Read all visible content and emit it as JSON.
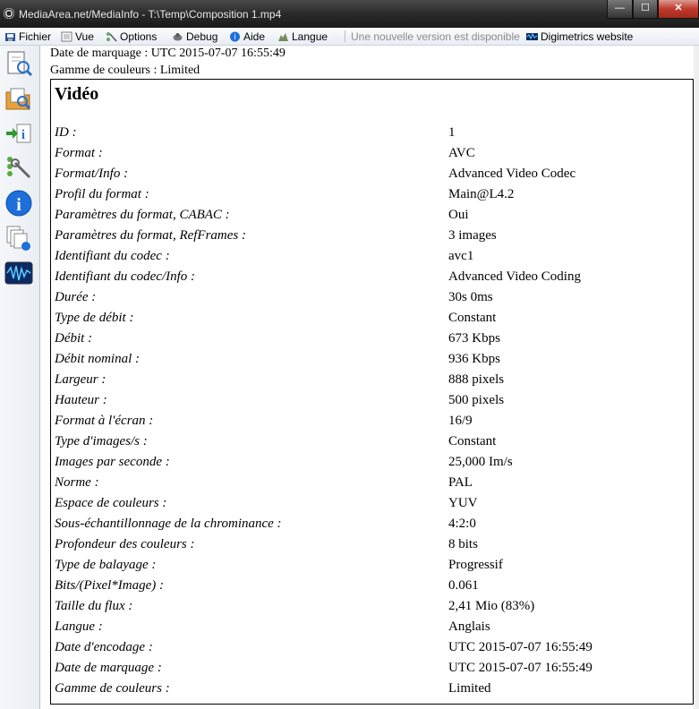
{
  "window": {
    "title": "MediaArea.net/MediaInfo - T:\\Temp\\Composition 1.mp4",
    "controls": {
      "minimize": "—",
      "maximize": "☐",
      "close": "✕"
    }
  },
  "menu": {
    "items": [
      {
        "label": "Fichier",
        "icon": "file-icon"
      },
      {
        "label": "Vue",
        "icon": "view-icon"
      },
      {
        "label": "Options",
        "icon": "options-icon"
      },
      {
        "label": "Debug",
        "icon": "debug-icon"
      },
      {
        "label": "Aide",
        "icon": "help-icon"
      },
      {
        "label": "Langue",
        "icon": "language-icon"
      }
    ],
    "update_notice": "Une nouvelle version est disponible",
    "website": {
      "label": "Digimetrics website",
      "icon": "digimetrics-icon"
    }
  },
  "toolbar": {
    "buttons": [
      {
        "icon": "open-file-icon"
      },
      {
        "icon": "open-folder-icon"
      },
      {
        "icon": "export-info-icon"
      },
      {
        "icon": "preferences-icon"
      },
      {
        "icon": "about-icon"
      },
      {
        "icon": "sheet-view-icon"
      },
      {
        "icon": "waveform-icon"
      }
    ]
  },
  "content": {
    "previous_lines": [
      "Date de marquage : UTC 2015-07-07 16:55:49",
      "Gamme de couleurs : Limited"
    ],
    "video": {
      "title": "Vidéo",
      "rows": [
        {
          "key": "ID :",
          "value": "1"
        },
        {
          "key": "Format :",
          "value": "AVC"
        },
        {
          "key": "Format/Info :",
          "value": "Advanced Video Codec"
        },
        {
          "key": "Profil du format :",
          "value": "Main@L4.2"
        },
        {
          "key": "Paramètres du format, CABAC :",
          "value": "Oui"
        },
        {
          "key": "Paramètres du format, RefFrames :",
          "value": "3 images"
        },
        {
          "key": "Identifiant du codec :",
          "value": "avc1"
        },
        {
          "key": "Identifiant du codec/Info :",
          "value": "Advanced Video Coding"
        },
        {
          "key": "Durée :",
          "value": "30s 0ms"
        },
        {
          "key": "Type de débit :",
          "value": "Constant"
        },
        {
          "key": "Débit :",
          "value": "673 Kbps"
        },
        {
          "key": "Débit nominal :",
          "value": "936 Kbps"
        },
        {
          "key": "Largeur :",
          "value": "888 pixels"
        },
        {
          "key": "Hauteur :",
          "value": "500 pixels"
        },
        {
          "key": "Format à l'écran :",
          "value": "16/9"
        },
        {
          "key": "Type d'images/s :",
          "value": "Constant"
        },
        {
          "key": "Images par seconde :",
          "value": "25,000 Im/s"
        },
        {
          "key": "Norme :",
          "value": "PAL"
        },
        {
          "key": "Espace de couleurs :",
          "value": "YUV"
        },
        {
          "key": "Sous-échantillonnage de la chrominance :",
          "value": "4:2:0"
        },
        {
          "key": "Profondeur des couleurs :",
          "value": "8 bits"
        },
        {
          "key": "Type de balayage :",
          "value": "Progressif"
        },
        {
          "key": "Bits/(Pixel*Image) :",
          "value": "0.061"
        },
        {
          "key": "Taille du flux :",
          "value": "2,41 Mio (83%)"
        },
        {
          "key": "Langue :",
          "value": "Anglais"
        },
        {
          "key": "Date d'encodage :",
          "value": "UTC 2015-07-07 16:55:49"
        },
        {
          "key": "Date de marquage :",
          "value": "UTC 2015-07-07 16:55:49"
        },
        {
          "key": "Gamme de couleurs :",
          "value": "Limited"
        }
      ]
    }
  }
}
